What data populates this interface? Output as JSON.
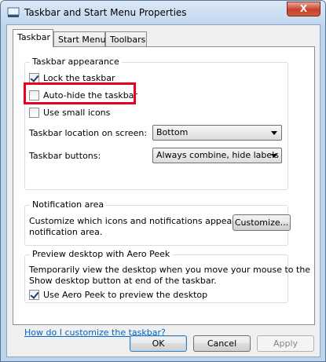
{
  "window": {
    "title": "Taskbar and Start Menu Properties",
    "close_glyph": "X"
  },
  "tabs": [
    {
      "label": "Taskbar",
      "active": true
    },
    {
      "label": "Start Menu",
      "active": false
    },
    {
      "label": "Toolbars",
      "active": false
    }
  ],
  "taskbar_appearance": {
    "title": "Taskbar appearance",
    "lock": {
      "label": "Lock the taskbar",
      "checked": true
    },
    "autohide": {
      "label": "Auto-hide the taskbar",
      "checked": false
    },
    "small_icons": {
      "label": "Use small icons",
      "checked": false
    },
    "location_label": "Taskbar location on screen:",
    "location_value": "Bottom",
    "buttons_label": "Taskbar buttons:",
    "buttons_value": "Always combine, hide labels"
  },
  "notification_area": {
    "title": "Notification area",
    "description_line1": "Customize which icons and notifications appear in the",
    "description_line2": "notification area.",
    "customize_label": "Customize..."
  },
  "aero_peek": {
    "title": "Preview desktop with Aero Peek",
    "description_line1": "Temporarily view the desktop when you move your mouse to the",
    "description_line2": "Show desktop button at end of the taskbar.",
    "use_peek": {
      "label": "Use Aero Peek to preview the desktop",
      "checked": true
    }
  },
  "help_link": "How do I customize the taskbar?",
  "footer": {
    "ok_label": "OK",
    "cancel_label": "Cancel",
    "apply_label": "Apply"
  },
  "colors": {
    "highlight": "#e8001c",
    "link": "#0066cc"
  }
}
